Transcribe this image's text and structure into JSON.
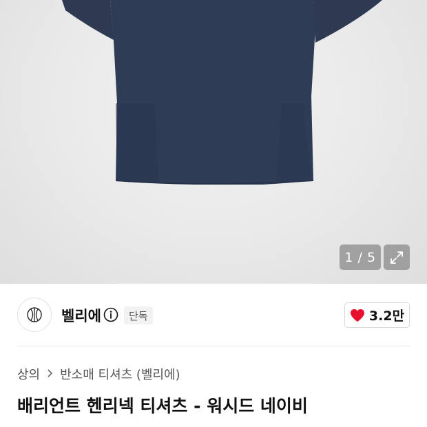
{
  "gallery": {
    "image_alt": "navy henley t-shirt",
    "counter": "1 / 5",
    "current_index": 1,
    "total_images": 5,
    "shirt_color": "#2f3c55",
    "icons": {
      "expand": "expand-icon"
    }
  },
  "brand": {
    "name": "벨리에",
    "exclusive_badge": "단독",
    "icons": {
      "logo": "brand-logo-icon",
      "info": "info-icon"
    }
  },
  "likes": {
    "count": "3.2만",
    "heart_color": "#e8112d",
    "icons": {
      "heart": "heart-icon"
    }
  },
  "breadcrumb": {
    "category": "상의",
    "subcategory": "반소매 티셔츠 (벨리에)",
    "icons": {
      "separator": "chevron-right-icon"
    }
  },
  "product": {
    "title": "배리언트 헨리넥 티셔츠 - 워시드 네이비"
  }
}
